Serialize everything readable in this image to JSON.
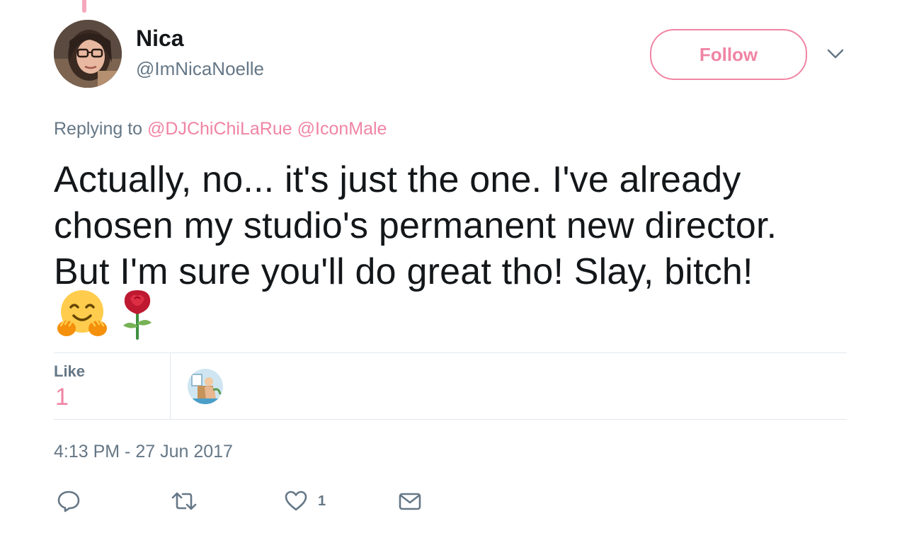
{
  "author": {
    "name": "Nica",
    "handle": "@ImNicaNoelle"
  },
  "follow_button": {
    "label": "Follow"
  },
  "reply_context": {
    "prefix": "Replying to",
    "mentions": [
      "@DJChiChiLaRue",
      "@IconMale"
    ]
  },
  "tweet": {
    "lines": [
      "Actually, no... it's just the one. I've already",
      "chosen my studio's permanent new director.",
      "But I'm sure you'll do great tho! Slay, bitch!"
    ],
    "emojis": [
      "hugging-face",
      "rose"
    ]
  },
  "stats": {
    "like_label": "Like",
    "like_count": "1"
  },
  "timestamp": "4:13 PM - 27 Jun 2017",
  "actions": {
    "like_count": "1"
  },
  "colors": {
    "accent": "#f084a4",
    "secondary_text": "#657786",
    "primary_text": "#14171a",
    "divider": "#e1e8ed"
  }
}
